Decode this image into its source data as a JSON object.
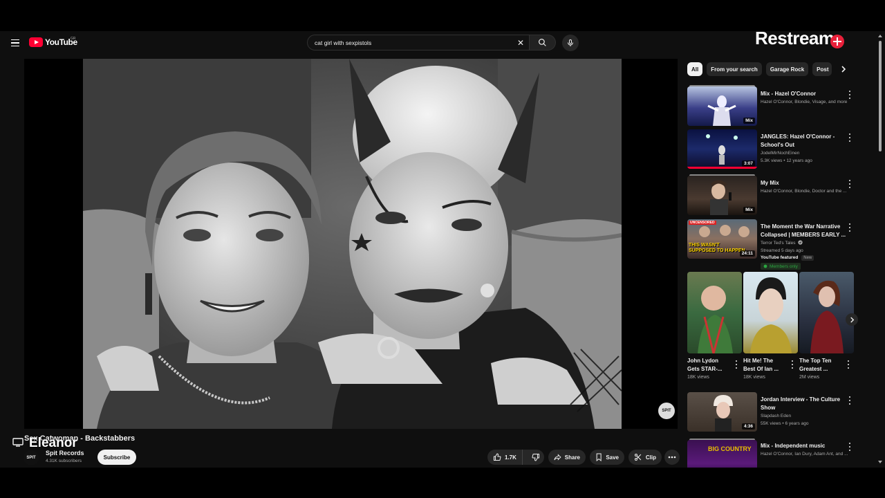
{
  "masthead": {
    "logo_text": "YouTube",
    "logo_country": "GR",
    "search_value": "cat girl with sexpistols",
    "overlay_brand": "Restream"
  },
  "player": {
    "watermark_label": "SPIT"
  },
  "video": {
    "title": "Sex Catwoman - Backstabbers",
    "overlay_name": "Eleanor",
    "channel_avatar_label": "SPIT",
    "channel_name": "Spit Records",
    "channel_subscribers": "4.31K subscribers",
    "subscribe_label": "Subscribe",
    "like_count": "1.7K",
    "share_label": "Share",
    "save_label": "Save",
    "clip_label": "Clip"
  },
  "sidebar": {
    "chips": [
      {
        "label": "All",
        "active": true
      },
      {
        "label": "From your search",
        "active": false
      },
      {
        "label": "Garage Rock",
        "active": false
      },
      {
        "label": "Post",
        "active": false
      }
    ],
    "recommendations": [
      {
        "title": "Mix - Hazel O'Connor",
        "line1": "Hazel O'Connor, Blondie, Visage, and more",
        "badge": "Mix"
      },
      {
        "title": "JANGLES: Hazel O'Connor - School's Out",
        "line1": "JodelMirNochEinen",
        "line2": "5.3K views • 12 years ago",
        "badge": "3:07"
      },
      {
        "title": "My Mix",
        "line1": "Hazel O'Connor, Blondie, Doctor and the ...",
        "badge": "Mix"
      },
      {
        "title": "The Moment the War Narrative Collapsed | MEMBERS EARLY ...",
        "line1": "Terror Ted's Tales",
        "line2": "Streamed 5 days ago",
        "featured": "YouTube featured",
        "new_label": "New",
        "members": "Members only",
        "badge": "24:11",
        "thumb_text": "THIS WASN'T SUPPOSED TO HAPPEN",
        "thumb_tag": "UNCENSORED"
      },
      {
        "title": "Jordan Interview - The Culture Show",
        "line1": "Slapdash Eden",
        "line2": "55K views • 6 years ago",
        "badge": "4:36"
      },
      {
        "title": "Mix - Independent music",
        "line1": "Hazel O'Connor, Ian Dury, Adam Ant, and ...",
        "thumb_text": "BIG COUNTRY"
      }
    ],
    "shorts": [
      {
        "title": "John Lydon Gets STAR-...",
        "views": "18K views"
      },
      {
        "title": "Hit Me! The Best Of Ian ...",
        "views": "18K views"
      },
      {
        "title": "The Top Ten Greatest ...",
        "views": "2M views"
      }
    ]
  }
}
